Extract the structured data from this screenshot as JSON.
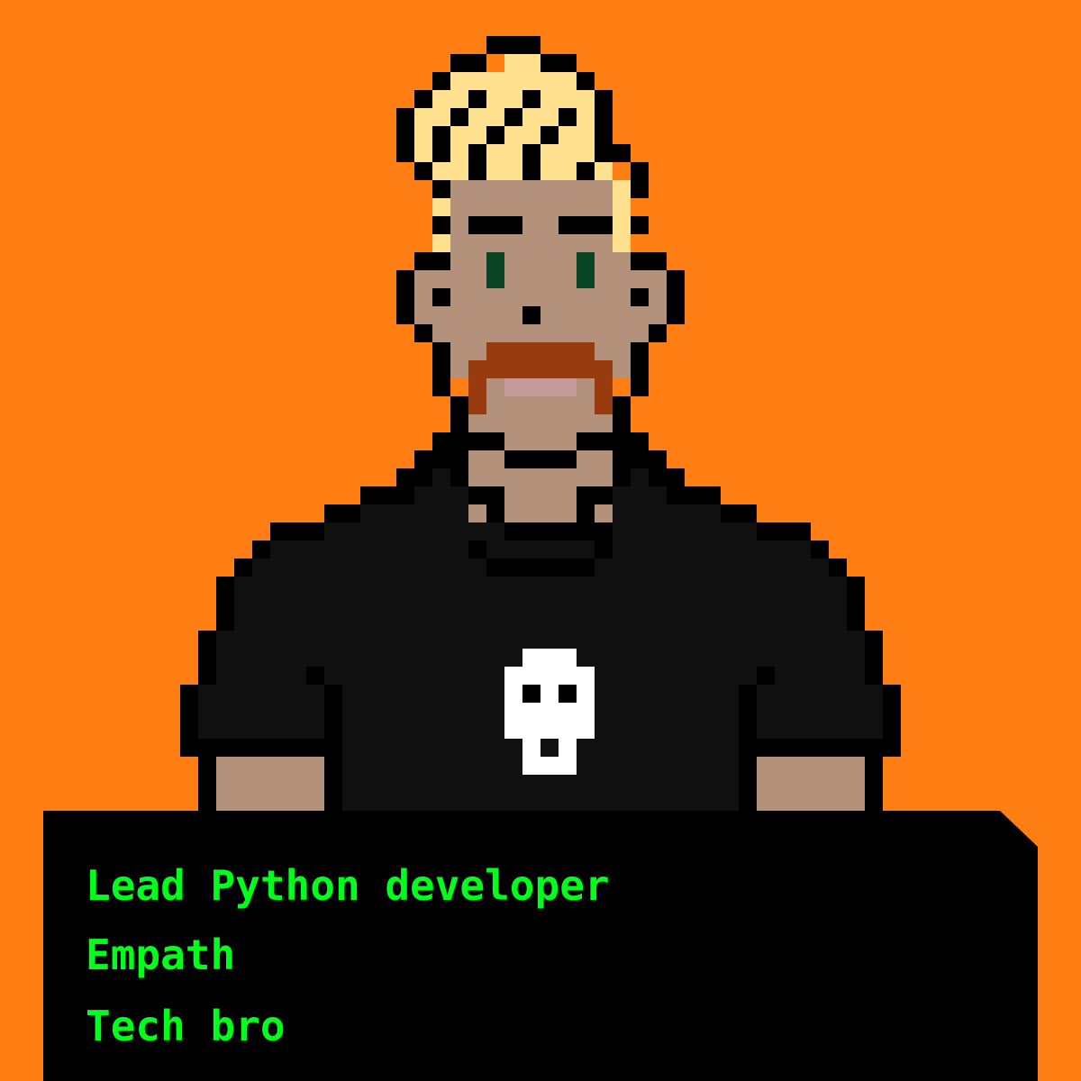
{
  "colors": {
    "background": "#ff7f14",
    "outline": "#000000",
    "hair": "#ffe08e",
    "skin": "#b3917b",
    "eyes": "#0a4625",
    "beard": "#983b0f",
    "mouth": "#c49a9a",
    "shirt": "#111111",
    "skull": "#ffffff",
    "panel": "#000000",
    "text": "#00ff1a"
  },
  "character": {
    "hair": "blonde spiky hair",
    "facial_hair": "ginger goatee",
    "eyes": "green eyes",
    "shirt": "black t-shirt",
    "shirt_graphic": "skull-icon"
  },
  "traits": [
    "Lead Python developer",
    "Empath",
    "Tech bro"
  ]
}
